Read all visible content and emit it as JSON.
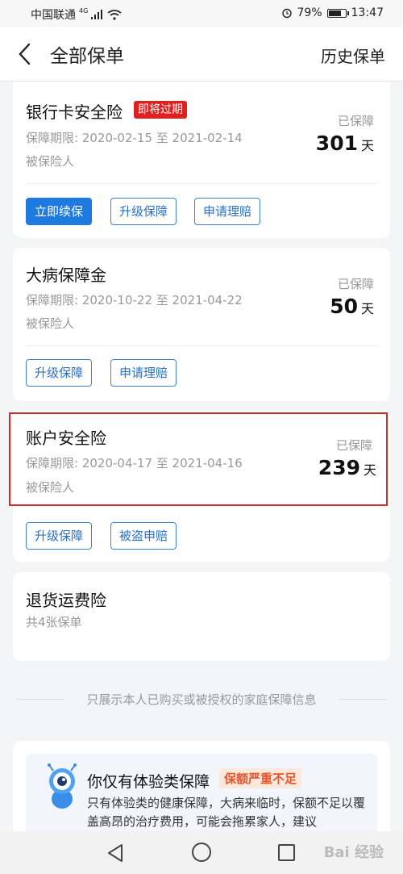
{
  "status_bar": {
    "carrier": "中国联通",
    "network": "4G",
    "battery": "79%",
    "battery_level": 0.79,
    "time": "13:47"
  },
  "header": {
    "title": "全部保单",
    "history_label": "历史保单"
  },
  "policies": [
    {
      "name": "银行卡安全险",
      "tag": "即将过期",
      "period": "保障期限: 2020-02-15 至 2021-02-14",
      "insured": "被保险人",
      "protected_label": "已保障",
      "days": "301",
      "days_unit": "天",
      "buttons": [
        "立即续保",
        "升级保障",
        "申请理赔"
      ]
    },
    {
      "name": "大病保障金",
      "period": "保障期限: 2020-10-22 至 2021-04-22",
      "insured": "被保险人",
      "protected_label": "已保障",
      "days": "50",
      "days_unit": "天",
      "buttons": [
        "升级保障",
        "申请理赔"
      ]
    },
    {
      "name": "账户安全险",
      "period": "保障期限: 2020-04-17 至 2021-04-16",
      "insured": "被保险人",
      "protected_label": "已保障",
      "days": "239",
      "days_unit": "天",
      "buttons": [
        "升级保障",
        "被盗申赔"
      ]
    },
    {
      "name": "退货运费险",
      "subtitle": "共4张保单"
    }
  ],
  "footer_note": "只展示本人已购买或被授权的家庭保障信息",
  "warning": {
    "title": "你仅有体验类保障",
    "tag": "保额严重不足",
    "text": "只有体验类的健康保障，大病来临时，保额不足以覆盖高昂的治疗费用，可能会拖累家人，建议"
  },
  "watermark": "Bai 经验"
}
